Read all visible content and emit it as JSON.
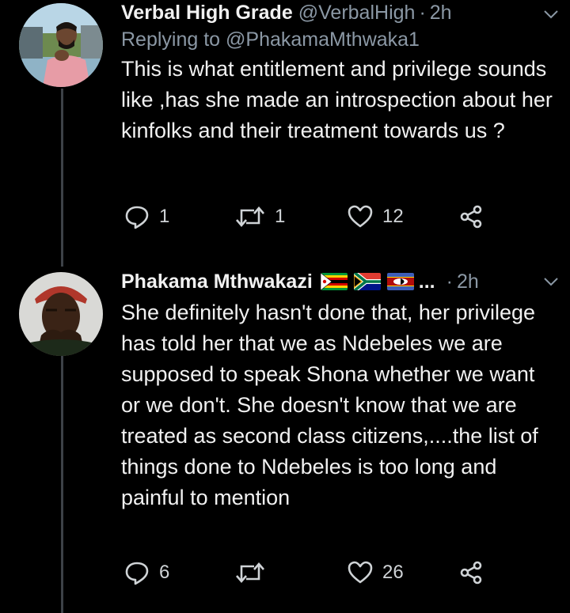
{
  "tweets": [
    {
      "name": "Verbal High Grade",
      "handle": "@VerbalHigh",
      "time": "2h",
      "replying": "Replying to @PhakamaMthwaka1",
      "text": "This is what entitlement and privilege sounds like ,has she made an introspection about her kinfolks and their treatment towards us ?",
      "replies": "1",
      "retweets": "1",
      "likes": "12"
    },
    {
      "name": "Phakama Mthwakazi",
      "flags": [
        "zimbabwe-flag-icon",
        "south-africa-flag-icon",
        "eswatini-flag-icon"
      ],
      "ellipsis": "...",
      "time": "2h",
      "text": "She definitely hasn't done that, her privilege has told her that we as Ndebeles we are supposed to speak Shona whether we want or we don't. She doesn't know that we are treated as second class citizens,....the list of things done to Ndebeles is too long and painful to mention",
      "replies": "6",
      "retweets": "",
      "likes": "26"
    }
  ],
  "icons": [
    "reply-icon",
    "retweet-icon",
    "like-icon",
    "share-icon",
    "chevron-down-icon"
  ],
  "colors": {
    "background": "#000000",
    "text": "#f1f1f1",
    "secondary": "#8b98a5",
    "thread_line": "#3d4147"
  }
}
